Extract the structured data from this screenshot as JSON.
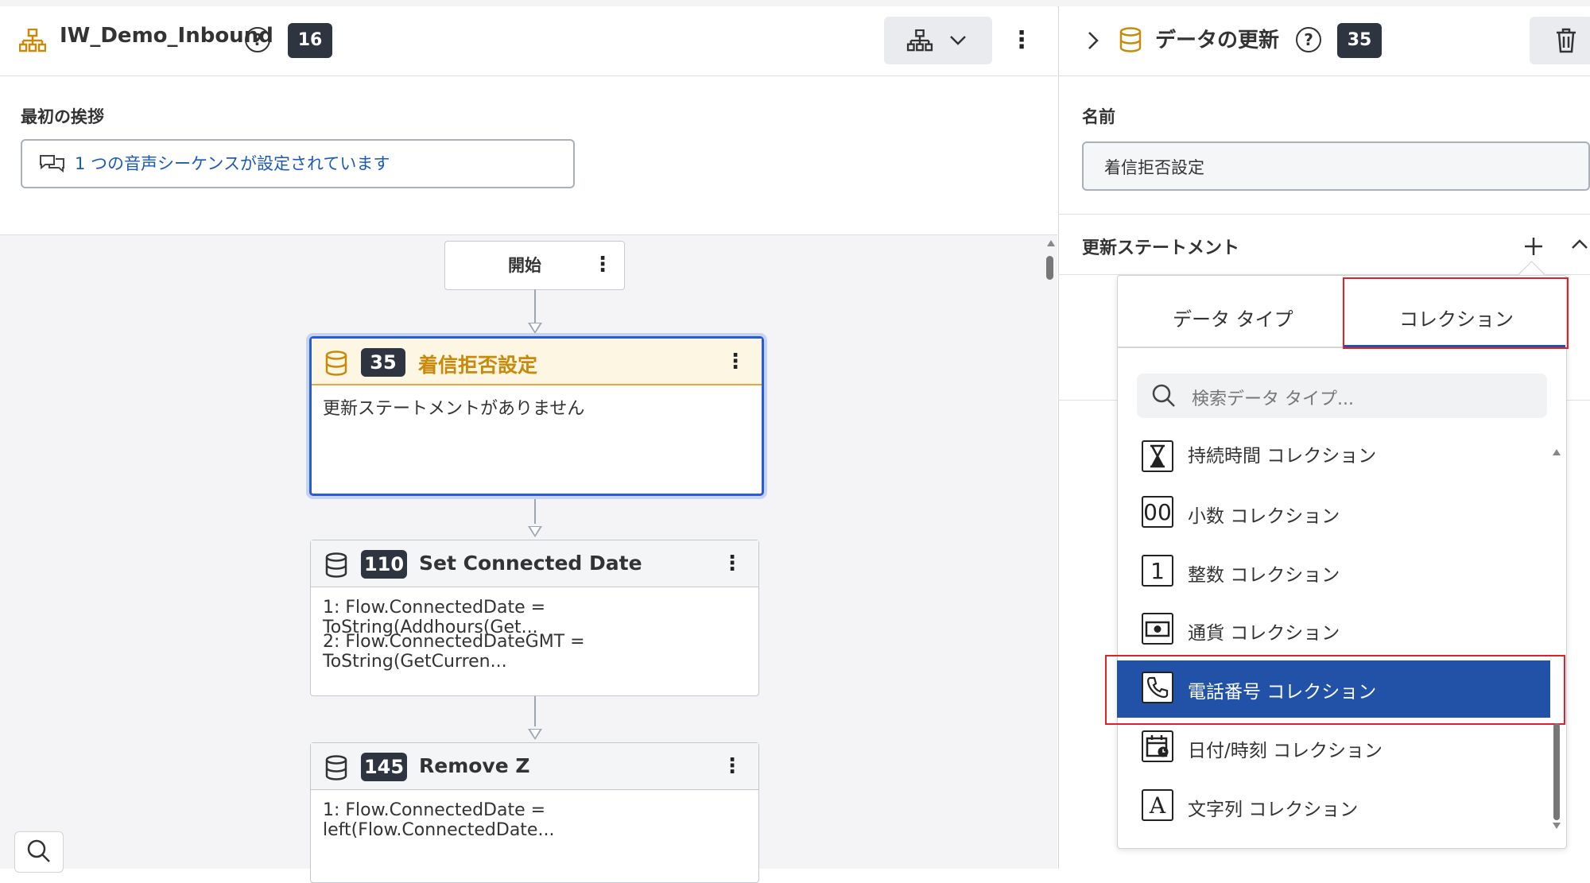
{
  "flow": {
    "title": "IW_Demo_Inbound",
    "help": "?",
    "count": "16"
  },
  "greeting": {
    "label": "最初の挨拶",
    "value": "1 つの音声シーケンスが設定されています"
  },
  "canvas": {
    "start_label": "開始",
    "nodes": [
      {
        "id": "35",
        "title": "着信拒否設定",
        "lines": [
          "更新ステートメントがありません"
        ],
        "selected": true
      },
      {
        "id": "110",
        "title": "Set Connected Date",
        "lines": [
          "1: Flow.ConnectedDate = ToString(Addhours(Get...",
          "2: Flow.ConnectedDateGMT = ToString(GetCurren..."
        ]
      },
      {
        "id": "145",
        "title": "Remove Z",
        "lines": [
          "1: Flow.ConnectedDate = left(Flow.ConnectedDate..."
        ]
      }
    ]
  },
  "panel": {
    "title": "データの更新",
    "help": "?",
    "count": "35",
    "name_label": "名前",
    "name_value": "着信拒否設定",
    "update_label": "更新ステートメント"
  },
  "popup": {
    "tabs": [
      "データ タイプ",
      "コレクション"
    ],
    "active_tab": "コレクション",
    "search_placeholder": "検索データ タイプ...",
    "items": [
      {
        "icon": "hourglass-icon",
        "label": "持続時間 コレクション"
      },
      {
        "icon": "decimal-icon",
        "glyph": "00",
        "label": "小数 コレクション"
      },
      {
        "icon": "integer-icon",
        "glyph": "1",
        "label": "整数 コレクション"
      },
      {
        "icon": "currency-icon",
        "label": "通貨 コレクション"
      },
      {
        "icon": "phone-icon",
        "label": "電話番号 コレクション",
        "selected": true
      },
      {
        "icon": "calendar-icon",
        "label": "日付/時刻 コレクション"
      },
      {
        "icon": "string-icon",
        "glyph": "A",
        "label": "文字列 コレクション"
      }
    ]
  },
  "colors": {
    "accent": "#2152a8",
    "highlight_red": "#e0202a",
    "node_gold": "#c98a0c",
    "badge": "#2e3440"
  }
}
